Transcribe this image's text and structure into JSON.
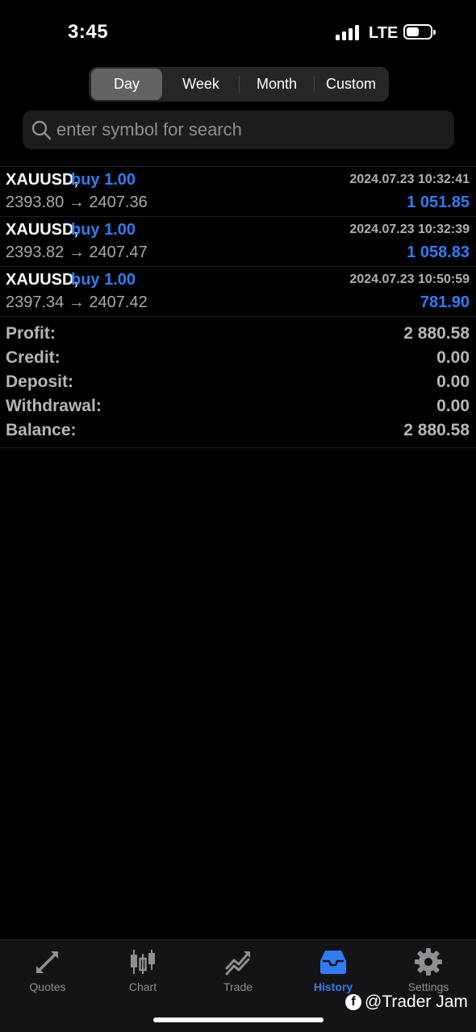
{
  "status_bar": {
    "time": "3:45",
    "network": "LTE",
    "battery_level": 0.55
  },
  "periods": [
    {
      "label": "Day",
      "active": true
    },
    {
      "label": "Week",
      "active": false
    },
    {
      "label": "Month",
      "active": false
    },
    {
      "label": "Custom",
      "active": false
    }
  ],
  "search": {
    "placeholder": "enter symbol for search",
    "value": ""
  },
  "deals": [
    {
      "symbol": "XAUUSD,",
      "side": "buy 1.00",
      "date": "2024.07.23 10:32:41",
      "prices": "2393.80 → 2407.36",
      "profit": "1 051.85"
    },
    {
      "symbol": "XAUUSD,",
      "side": "buy 1.00",
      "date": "2024.07.23 10:32:39",
      "prices": "2393.82 → 2407.47",
      "profit": "1 058.83"
    },
    {
      "symbol": "XAUUSD,",
      "side": "buy 1.00",
      "date": "2024.07.23 10:50:59",
      "prices": "2397.34 → 2407.42",
      "profit": "781.90"
    }
  ],
  "summary": [
    {
      "label": "Profit:",
      "value": "2 880.58"
    },
    {
      "label": "Credit:",
      "value": "0.00"
    },
    {
      "label": "Deposit:",
      "value": "0.00"
    },
    {
      "label": "Withdrawal:",
      "value": "0.00"
    },
    {
      "label": "Balance:",
      "value": "2 880.58"
    }
  ],
  "tabs": [
    {
      "label": "Quotes",
      "icon": "quotes-icon",
      "active": false
    },
    {
      "label": "Chart",
      "icon": "chart-icon",
      "active": false
    },
    {
      "label": "Trade",
      "icon": "trade-icon",
      "active": false
    },
    {
      "label": "History",
      "icon": "history-icon",
      "active": true
    },
    {
      "label": "Settings",
      "icon": "gear-icon",
      "active": false
    }
  ],
  "watermark": {
    "icon": "facebook-icon",
    "text": "@Trader Jam"
  },
  "colors": {
    "accent": "#2f7df5",
    "background": "#000000",
    "muted": "#8e8e93"
  }
}
